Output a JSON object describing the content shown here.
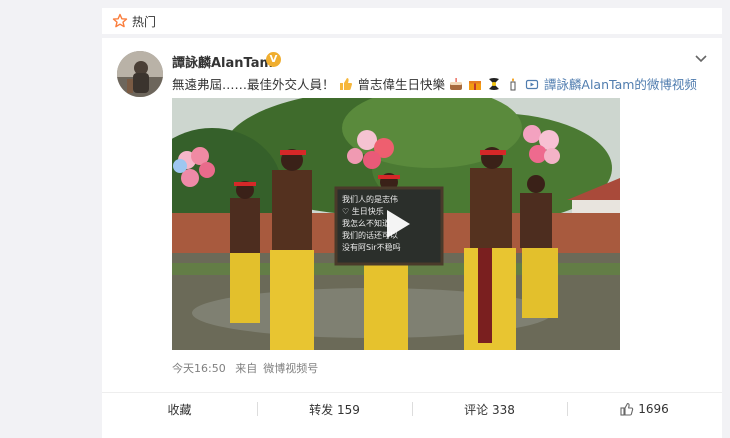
{
  "hot": {
    "label": "热门",
    "icon": "star-icon"
  },
  "post": {
    "user_name": "譚詠麟AlanTam",
    "verified_badge": "V",
    "text_before": "無遠弗屆……最佳外交人員！",
    "text_middle": "曾志偉生日快樂",
    "video_link": "譚詠麟AlanTam的微博视频",
    "blackboard_text": [
      "我们人的是志伟",
      "♡ 生日快乐",
      "我怎么不知道",
      "我们的话还可以",
      "没有阿Sir不稳吗"
    ],
    "time": "今天16:50",
    "source_prefix": "来自",
    "source": "微博视频号"
  },
  "actions": {
    "favorite": "收藏",
    "repost": "转发 159",
    "comment": "评论 338",
    "like": "1696"
  },
  "colors": {
    "link": "#507daf",
    "badge": "#f0ae2f",
    "accent": "#fa7d3c"
  }
}
